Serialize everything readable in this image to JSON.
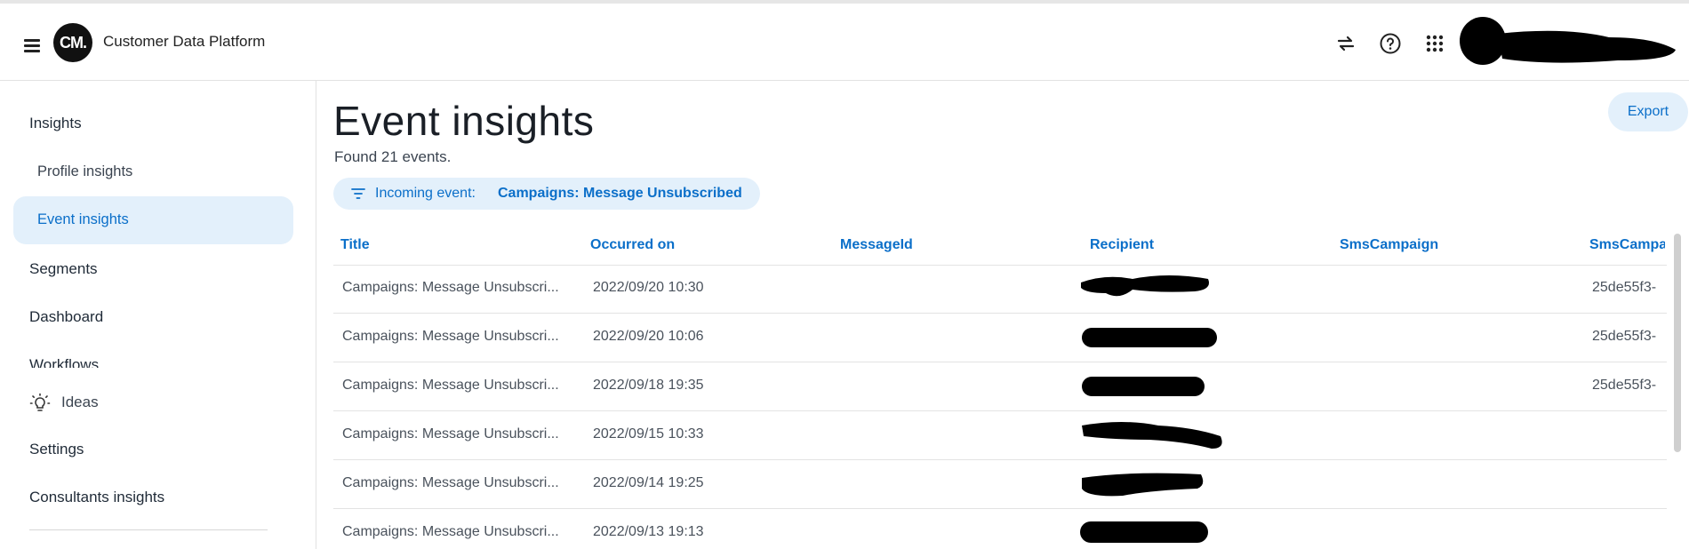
{
  "header": {
    "logo_text": "CM.",
    "app_title": "Customer Data Platform",
    "icons": [
      "menu-icon",
      "swap-icon",
      "help-icon",
      "apps-grid-icon"
    ]
  },
  "sidebar": {
    "items": [
      {
        "label": "Insights"
      },
      {
        "label": "Profile insights"
      },
      {
        "label": "Event insights"
      },
      {
        "label": "Segments"
      },
      {
        "label": "Dashboard"
      },
      {
        "label": "Workflows"
      },
      {
        "label": "Ideas"
      },
      {
        "label": "Settings"
      },
      {
        "label": "Consultants insights"
      }
    ]
  },
  "main": {
    "title": "Event insights",
    "count_text": "Found 21 events.",
    "export_label": "Export",
    "filter": {
      "prefix": "Incoming event:",
      "value": "Campaigns: Message Unsubscribed"
    }
  },
  "table": {
    "columns": [
      "Title",
      "Occurred on",
      "MessageId",
      "Recipient",
      "SmsCampaign",
      "SmsCampa"
    ],
    "rows": [
      {
        "title": "Campaigns: Message Unsubscri...",
        "occurred": "2022/09/20 10:30",
        "smscampaign2": "25de55f3-"
      },
      {
        "title": "Campaigns: Message Unsubscri...",
        "occurred": "2022/09/20 10:06",
        "smscampaign2": "25de55f3-"
      },
      {
        "title": "Campaigns: Message Unsubscri...",
        "occurred": "2022/09/18 19:35",
        "smscampaign2": "25de55f3-"
      },
      {
        "title": "Campaigns: Message Unsubscri...",
        "occurred": "2022/09/15 10:33",
        "smscampaign2": ""
      },
      {
        "title": "Campaigns: Message Unsubscri...",
        "occurred": "2022/09/14 19:25",
        "smscampaign2": ""
      },
      {
        "title": "Campaigns: Message Unsubscri...",
        "occurred": "2022/09/13 19:13",
        "smscampaign2": ""
      }
    ]
  },
  "colors": {
    "accent": "#0b6fc9",
    "accent_bg": "#e3f0fb",
    "text": "#1f2a37"
  }
}
